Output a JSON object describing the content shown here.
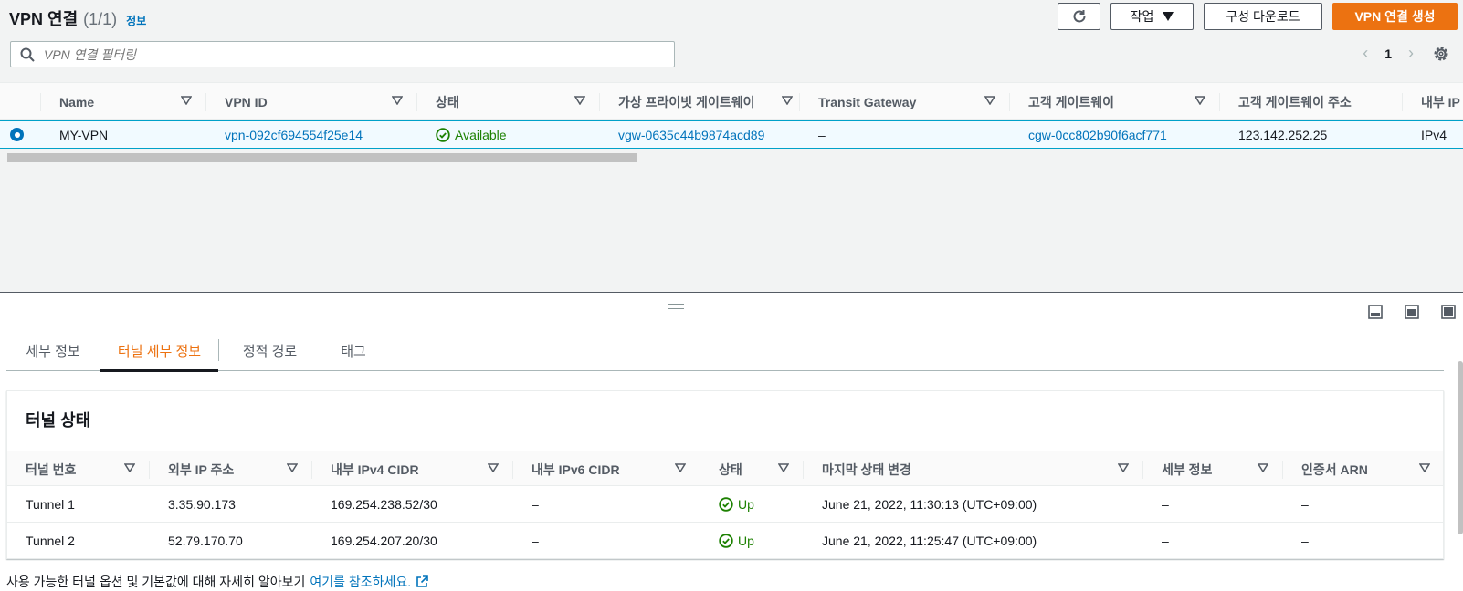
{
  "header": {
    "title": "VPN 연결",
    "count": "(1/1)",
    "info_link": "정보",
    "refresh_icon": "refresh-icon",
    "actions_label": "작업",
    "download_label": "구성 다운로드",
    "create_label": "VPN 연결 생성"
  },
  "search": {
    "placeholder": "VPN 연결 필터링"
  },
  "pagination": {
    "page": "1"
  },
  "table": {
    "columns": [
      "Name",
      "VPN ID",
      "상태",
      "가상 프라이빗 게이트웨이",
      "Transit Gateway",
      "고객 게이트웨이",
      "고객 게이트웨이 주소",
      "내부 IP"
    ],
    "row": {
      "name": "MY-VPN",
      "vpn_id": "vpn-092cf694554f25e14",
      "status": "Available",
      "vgw": "vgw-0635c44b9874acd89",
      "tgw": "–",
      "cgw": "cgw-0cc802b90f6acf771",
      "cgw_address": "123.142.252.25",
      "inner_ip": "IPv4"
    }
  },
  "tabs": [
    "세부 정보",
    "터널 세부 정보",
    "정적 경로",
    "태그"
  ],
  "active_tab": "터널 세부 정보",
  "tunnel_panel": {
    "title": "터널 상태",
    "columns": [
      "터널 번호",
      "외부 IP 주소",
      "내부 IPv4 CIDR",
      "내부 IPv6 CIDR",
      "상태",
      "마지막 상태 변경",
      "세부 정보",
      "인증서 ARN"
    ],
    "rows": [
      {
        "number": "Tunnel 1",
        "outside_ip": "3.35.90.173",
        "ipv4_cidr": "169.254.238.52/30",
        "ipv6_cidr": "–",
        "status": "Up",
        "last_change": "June 21, 2022, 11:30:13 (UTC+09:00)",
        "details": "–",
        "cert_arn": "–"
      },
      {
        "number": "Tunnel 2",
        "outside_ip": "52.79.170.70",
        "ipv4_cidr": "169.254.207.20/30",
        "ipv6_cidr": "–",
        "status": "Up",
        "last_change": "June 21, 2022, 11:25:47 (UTC+09:00)",
        "details": "–",
        "cert_arn": "–"
      }
    ]
  },
  "footer": {
    "text": "사용 가능한 터널 옵션 및 기본값에 대해 자세히 알아보기",
    "link": "여기를 참조하세요."
  },
  "colors": {
    "accent": "#ec7211",
    "link": "#0073bb",
    "success": "#1d8102"
  }
}
